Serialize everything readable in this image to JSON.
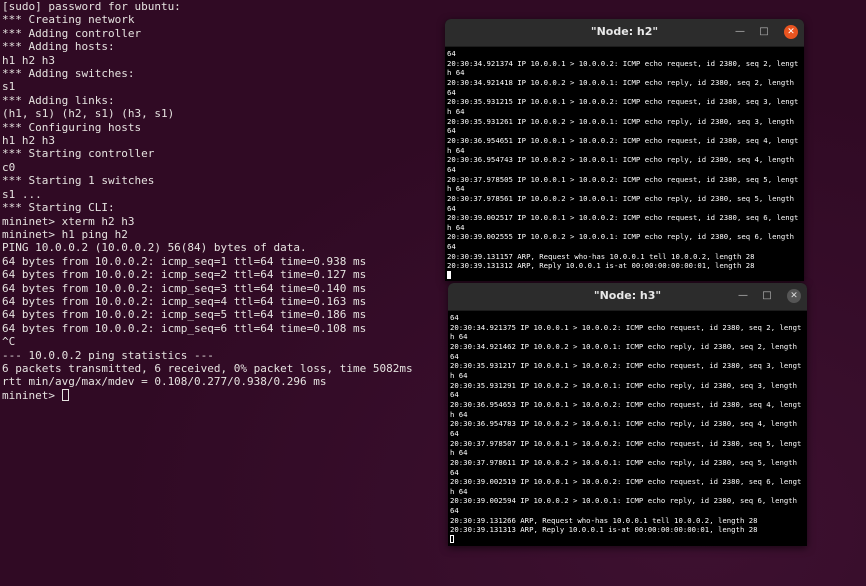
{
  "main_terminal": {
    "lines": [
      "[sudo] password for ubuntu:",
      "*** Creating network",
      "*** Adding controller",
      "*** Adding hosts:",
      "h1 h2 h3",
      "*** Adding switches:",
      "s1",
      "*** Adding links:",
      "(h1, s1) (h2, s1) (h3, s1)",
      "*** Configuring hosts",
      "h1 h2 h3",
      "*** Starting controller",
      "c0",
      "*** Starting 1 switches",
      "s1 ...",
      "*** Starting CLI:",
      "mininet> xterm h2 h3",
      "mininet> h1 ping h2",
      "PING 10.0.0.2 (10.0.0.2) 56(84) bytes of data.",
      "64 bytes from 10.0.0.2: icmp_seq=1 ttl=64 time=0.938 ms",
      "64 bytes from 10.0.0.2: icmp_seq=2 ttl=64 time=0.127 ms",
      "64 bytes from 10.0.0.2: icmp_seq=3 ttl=64 time=0.140 ms",
      "64 bytes from 10.0.0.2: icmp_seq=4 ttl=64 time=0.163 ms",
      "64 bytes from 10.0.0.2: icmp_seq=5 ttl=64 time=0.186 ms",
      "64 bytes from 10.0.0.2: icmp_seq=6 ttl=64 time=0.108 ms",
      "^C",
      "--- 10.0.0.2 ping statistics ---",
      "6 packets transmitted, 6 received, 0% packet loss, time 5082ms",
      "rtt min/avg/max/mdev = 0.108/0.277/0.938/0.296 ms"
    ],
    "prompt": "mininet> "
  },
  "windows": {
    "h2": {
      "title": "\"Node: h2\"",
      "lines": [
        "64",
        "20:30:34.921374 IP 10.0.0.1 > 10.0.0.2: ICMP echo request, id 2380, seq 2, lengt",
        "h 64",
        "20:30:34.921418 IP 10.0.0.2 > 10.0.0.1: ICMP echo reply, id 2380, seq 2, length",
        "64",
        "20:30:35.931215 IP 10.0.0.1 > 10.0.0.2: ICMP echo request, id 2380, seq 3, lengt",
        "h 64",
        "20:30:35.931261 IP 10.0.0.2 > 10.0.0.1: ICMP echo reply, id 2380, seq 3, length",
        "64",
        "20:30:36.954651 IP 10.0.0.1 > 10.0.0.2: ICMP echo request, id 2380, seq 4, lengt",
        "h 64",
        "20:30:36.954743 IP 10.0.0.2 > 10.0.0.1: ICMP echo reply, id 2380, seq 4, length",
        "64",
        "20:30:37.978505 IP 10.0.0.1 > 10.0.0.2: ICMP echo request, id 2380, seq 5, lengt",
        "h 64",
        "20:30:37.978561 IP 10.0.0.2 > 10.0.0.1: ICMP echo reply, id 2380, seq 5, length",
        "64",
        "20:30:39.002517 IP 10.0.0.1 > 10.0.0.2: ICMP echo request, id 2380, seq 6, lengt",
        "h 64",
        "20:30:39.002555 IP 10.0.0.2 > 10.0.0.1: ICMP echo reply, id 2380, seq 6, length",
        "64",
        "20:30:39.131157 ARP, Request who-has 10.0.0.1 tell 10.0.0.2, length 28",
        "20:30:39.131312 ARP, Reply 10.0.0.1 is-at 00:00:00:00:00:01, length 28"
      ]
    },
    "h3": {
      "title": "\"Node: h3\"",
      "lines": [
        "64",
        "20:30:34.921375 IP 10.0.0.1 > 10.0.0.2: ICMP echo request, id 2380, seq 2, lengt",
        "h 64",
        "20:30:34.921462 IP 10.0.0.2 > 10.0.0.1: ICMP echo reply, id 2380, seq 2, length",
        "64",
        "20:30:35.931217 IP 10.0.0.1 > 10.0.0.2: ICMP echo request, id 2380, seq 3, lengt",
        "h 64",
        "20:30:35.931291 IP 10.0.0.2 > 10.0.0.1: ICMP echo reply, id 2380, seq 3, length",
        "64",
        "20:30:36.954653 IP 10.0.0.1 > 10.0.0.2: ICMP echo request, id 2380, seq 4, lengt",
        "h 64",
        "20:30:36.954783 IP 10.0.0.2 > 10.0.0.1: ICMP echo reply, id 2380, seq 4, length",
        "64",
        "20:30:37.978507 IP 10.0.0.1 > 10.0.0.2: ICMP echo request, id 2380, seq 5, lengt",
        "h 64",
        "20:30:37.978611 IP 10.0.0.2 > 10.0.0.1: ICMP echo reply, id 2380, seq 5, length",
        "64",
        "20:30:39.002519 IP 10.0.0.1 > 10.0.0.2: ICMP echo request, id 2380, seq 6, lengt",
        "h 64",
        "20:30:39.002594 IP 10.0.0.2 > 10.0.0.1: ICMP echo reply, id 2380, seq 6, length",
        "64",
        "20:30:39.131266 ARP, Request who-has 10.0.0.1 tell 10.0.0.2, length 28",
        "20:30:39.131313 ARP, Reply 10.0.0.1 is-at 00:00:00:00:00:01, length 28"
      ]
    }
  },
  "icons": {
    "minimize": "minimize-icon",
    "maximize": "maximize-icon",
    "close": "close-icon"
  },
  "colors": {
    "desktop_bg": "#300a24",
    "terminal_text": "#e6e3e0",
    "close_accent": "#e95420"
  }
}
